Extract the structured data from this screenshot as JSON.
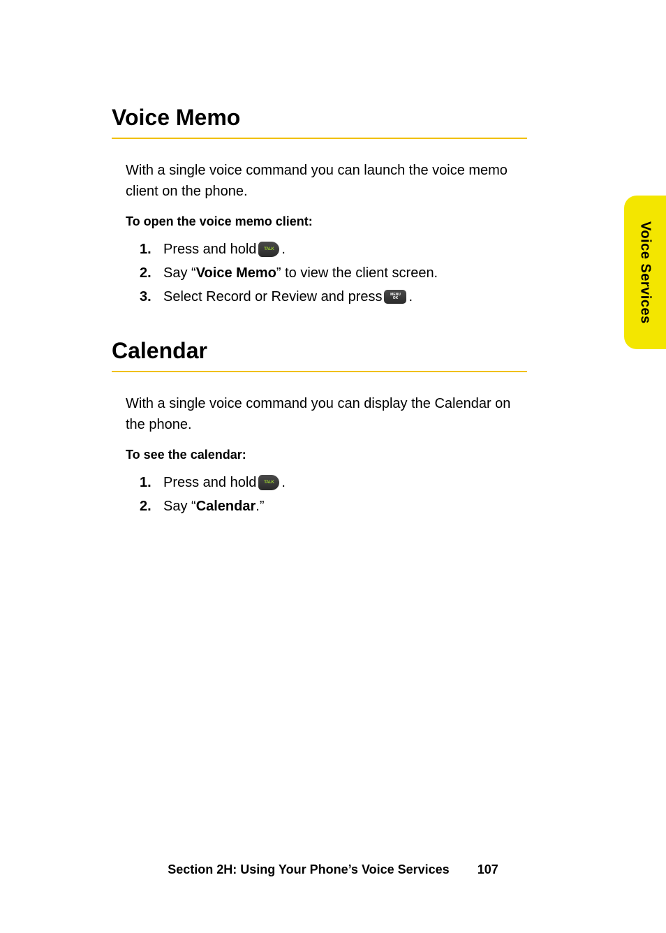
{
  "sections": [
    {
      "heading": "Voice Memo",
      "intro": "With a single voice command you can launch the voice memo client on the phone.",
      "subheading": "To open the voice memo client:",
      "steps": [
        {
          "marker": "1.",
          "prefix": "Press and hold ",
          "icon": "talk",
          "suffix": "."
        },
        {
          "marker": "2.",
          "prefix": "Say “",
          "bold": "Voice Memo",
          "suffix": "” to view the client screen."
        },
        {
          "marker": "3.",
          "prefix": "Select Record or Review and press ",
          "icon": "menu",
          "suffix": "."
        }
      ]
    },
    {
      "heading": "Calendar",
      "intro": "With a single voice command you can display the Calendar on the phone.",
      "subheading": "To see the calendar:",
      "steps": [
        {
          "marker": "1.",
          "prefix": "Press and hold ",
          "icon": "talk",
          "suffix": "."
        },
        {
          "marker": "2.",
          "prefix": "Say “",
          "bold": "Calendar",
          "suffix": ".”"
        }
      ]
    }
  ],
  "sidetab": "Voice Services",
  "footer": {
    "section": "Section 2H: Using Your Phone’s Voice Services",
    "page": "107"
  }
}
